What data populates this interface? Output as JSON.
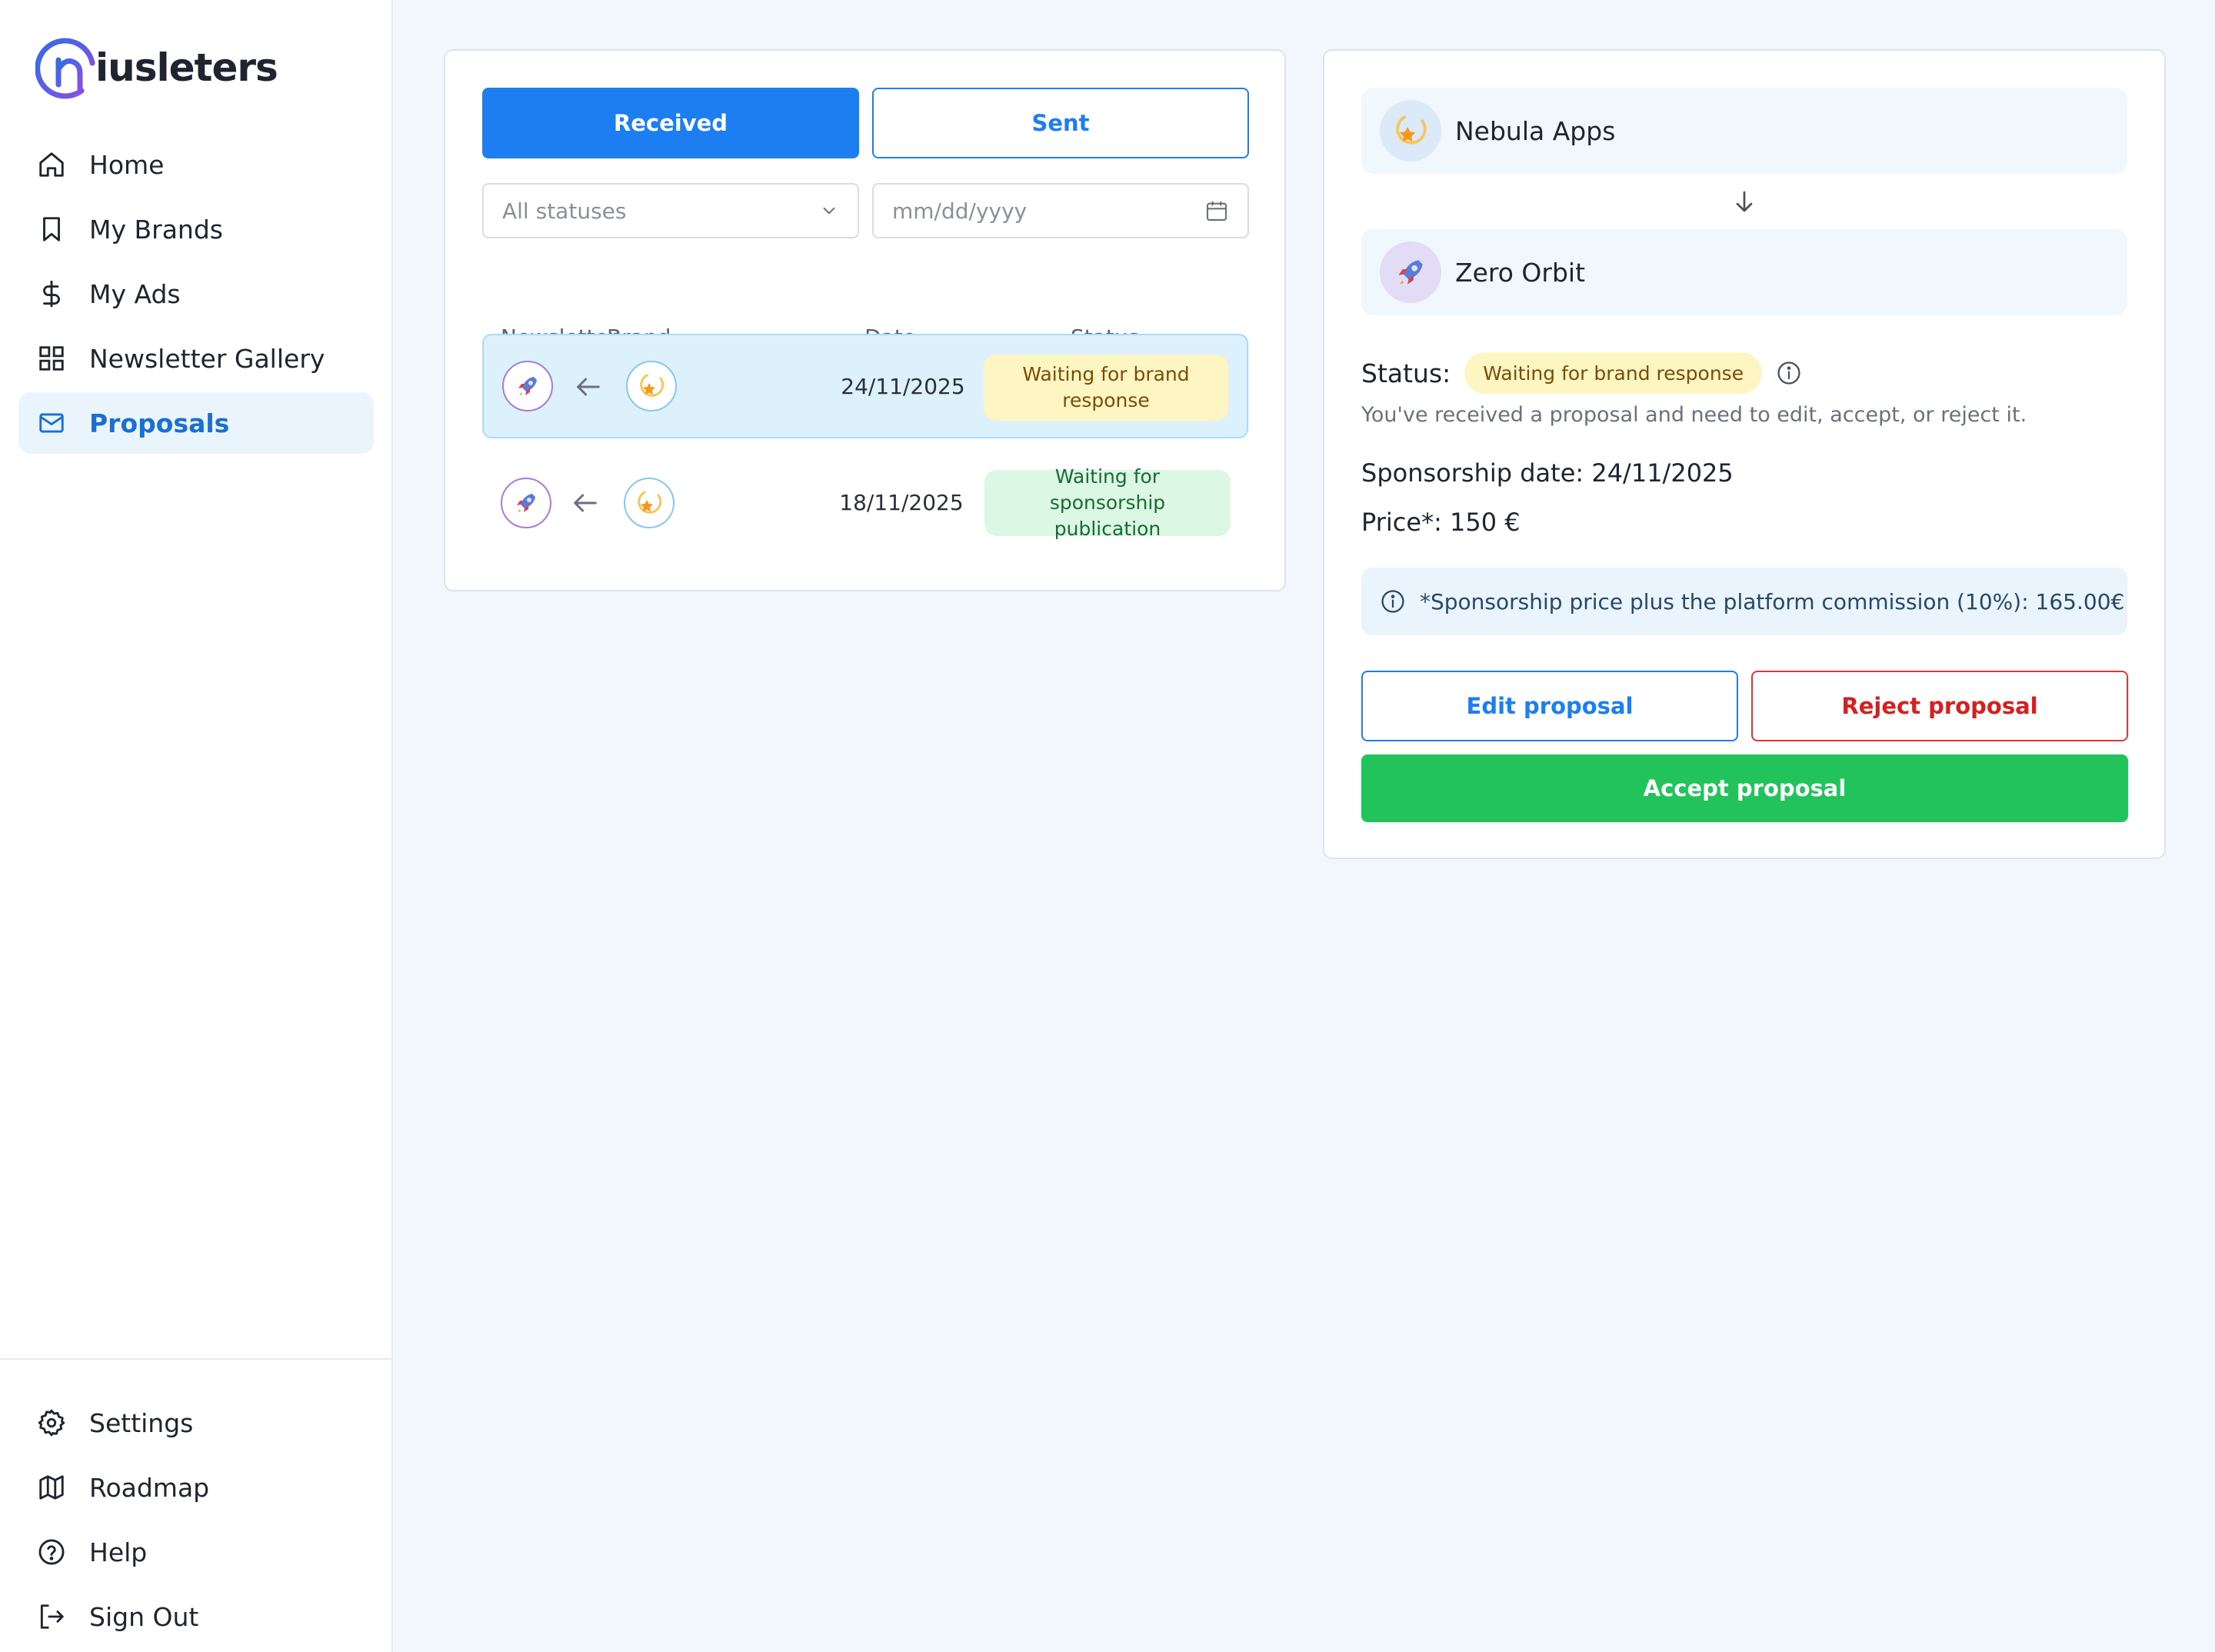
{
  "app": {
    "logo_text": "iusleters"
  },
  "sidebar": {
    "items": [
      {
        "label": "Home",
        "icon": "home-icon"
      },
      {
        "label": "My Brands",
        "icon": "bookmark-icon"
      },
      {
        "label": "My Ads",
        "icon": "dollar-icon"
      },
      {
        "label": "Newsletter Gallery",
        "icon": "grid-icon"
      },
      {
        "label": "Proposals",
        "icon": "mail-icon",
        "active": true
      }
    ],
    "bottom_items": [
      {
        "label": "Settings",
        "icon": "gear-icon"
      },
      {
        "label": "Roadmap",
        "icon": "map-icon"
      },
      {
        "label": "Help",
        "icon": "help-circle-icon"
      },
      {
        "label": "Sign Out",
        "icon": "sign-out-icon"
      }
    ]
  },
  "proposals_list": {
    "tabs": {
      "received": "Received",
      "sent": "Sent",
      "active": "received"
    },
    "filters": {
      "status_value": "All statuses",
      "date_placeholder": "mm/dd/yyyy"
    },
    "columns": {
      "newsletter": "Newsletter",
      "brand": "Brand",
      "date": "Date",
      "status": "Status"
    },
    "rows": [
      {
        "date": "24/11/2025",
        "status_line1": "Waiting for brand",
        "status_line2": "response",
        "selected": true
      },
      {
        "date": "18/11/2025",
        "status_line1": "Waiting for sponsorship",
        "status_line2": "publication",
        "selected": false
      }
    ]
  },
  "detail": {
    "from_name": "Nebula Apps",
    "to_name": "Zero Orbit",
    "status_label": "Status:",
    "status_value": "Waiting for brand response",
    "status_help": "You've received a proposal and need to edit, accept, or reject it.",
    "sponsorship_date": "Sponsorship date: 24/11/2025",
    "price": "Price*: 150 €",
    "note": "*Sponsorship price plus the platform commission (10%): 165.00€",
    "buttons": {
      "edit": "Edit proposal",
      "reject": "Reject proposal",
      "accept": "Accept proposal"
    }
  },
  "colors": {
    "primary": "#1c7ef0",
    "danger": "#d71f1f",
    "success": "#22c35b",
    "background": "#f1f7fd"
  }
}
